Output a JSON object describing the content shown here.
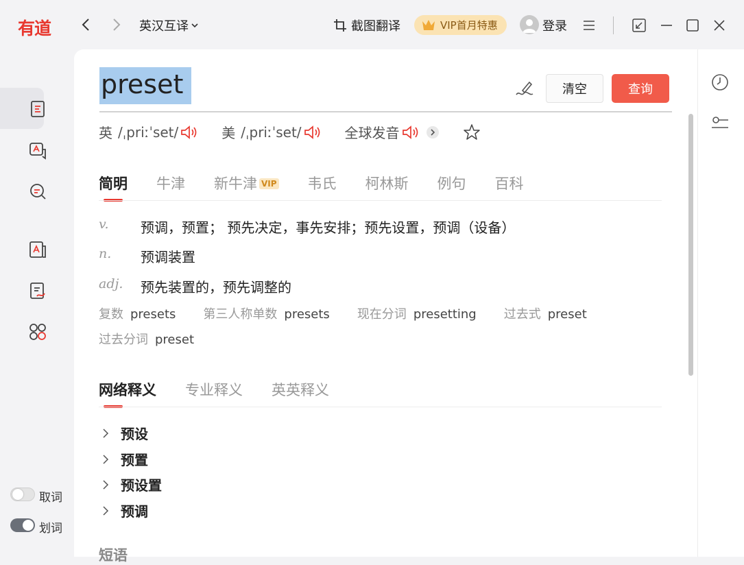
{
  "app": {
    "logo": "有道"
  },
  "titlebar": {
    "mode": "英汉互译",
    "screenshot_translate": "截图翻译",
    "vip_offer": "VIP首月特惠",
    "login": "登录"
  },
  "sidebar": {
    "toggles": [
      {
        "label": "取词",
        "on": false
      },
      {
        "label": "划词",
        "on": true
      }
    ]
  },
  "search": {
    "query": "preset",
    "clear_label": "清空",
    "query_label": "查询"
  },
  "pronunciation": {
    "uk_label": "英",
    "uk_ipa": "/ˌpriːˈset/",
    "us_label": "美",
    "us_ipa": "/ˌpriːˈset/",
    "global_label": "全球发音"
  },
  "dict_tabs": [
    {
      "label": "简明",
      "active": true
    },
    {
      "label": "牛津",
      "active": false
    },
    {
      "label": "新牛津",
      "active": false,
      "badge": "VIP"
    },
    {
      "label": "韦氏",
      "active": false
    },
    {
      "label": "柯林斯",
      "active": false
    },
    {
      "label": "例句",
      "active": false
    },
    {
      "label": "百科",
      "active": false
    }
  ],
  "definitions": [
    {
      "pos": "v.",
      "text": "预调，预置； 预先决定，事先安排；预先设置，预调（设备）"
    },
    {
      "pos": "n.",
      "text": "预调装置"
    },
    {
      "pos": "adj.",
      "text": "预先装置的，预先调整的"
    }
  ],
  "word_forms": [
    {
      "label": "复数",
      "value": "presets"
    },
    {
      "label": "第三人称单数",
      "value": "presets"
    },
    {
      "label": "现在分词",
      "value": "presetting"
    },
    {
      "label": "过去式",
      "value": "preset"
    },
    {
      "label": "过去分词",
      "value": "preset"
    }
  ],
  "meaning_tabs": [
    {
      "label": "网络释义",
      "active": true
    },
    {
      "label": "专业释义",
      "active": false
    },
    {
      "label": "英英释义",
      "active": false
    }
  ],
  "web_meanings": [
    "预设",
    "预置",
    "预设置",
    "预调"
  ],
  "next_section": "短语",
  "colors": {
    "accent": "#e8382f",
    "query_button": "#f15b4a",
    "selection": "#a8ccee",
    "vip_bg": "#fbe3b3"
  }
}
